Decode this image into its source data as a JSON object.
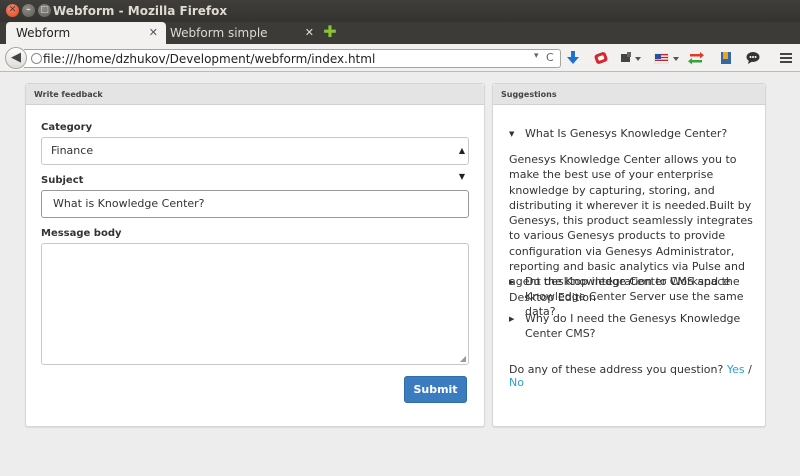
{
  "window": {
    "title": "Webform - Mozilla Firefox",
    "close_glyph": "✕",
    "minimize_glyph": "–",
    "maximize_glyph": "□"
  },
  "tabs": [
    {
      "label": "Webform",
      "active": true
    },
    {
      "label": "Webform simple",
      "active": false
    }
  ],
  "tab_close_glyph": "✕",
  "new_tab_glyph": "✚",
  "nav": {
    "back_glyph": "◀",
    "url": "file:///home/dzhukov/Development/webform/index.html",
    "url_dropdown_glyph": "▾",
    "reload_glyph": "C"
  },
  "toolbar_icons": [
    "download-arrow-icon",
    "addon-red-icon",
    "addon-dark-icon",
    "flag-us-icon",
    "sync-arrows-icon",
    "bookmarks-icon",
    "chat-icon",
    "menu-icon"
  ],
  "colors": {
    "accent": "#3a7cbf",
    "link": "#2a9fd6",
    "window_close": "#e2451d"
  },
  "feedback": {
    "header": "Write feedback",
    "category_label": "Category",
    "category_value": "Finance",
    "subject_label": "Subject",
    "subject_value": "What is Knowledge Center?",
    "message_label": "Message body",
    "message_value": "",
    "submit_label": "Submit"
  },
  "suggestions": {
    "header": "Suggestions",
    "items": [
      {
        "question": "What Is Genesys Knowledge Center?",
        "expanded": true,
        "answer": "Genesys Knowledge Center allows you to make the best use of your enterprise knowledge by capturing, storing, and distributing it wherever it is needed.Built by Genesys, this product seamlessly integrates to various Genesys products to provide configuration via Genesys Administrator, reporting and basic analytics via Pulse and agent desktop integration to Workspace Desktop Edition"
      },
      {
        "question": "Do the Knowledge Center CMS and the Knowledge Center Server use the same data?",
        "expanded": false
      },
      {
        "question": "Why do I need the Genesys Knowledge Center CMS?",
        "expanded": false
      }
    ],
    "address_prompt": "Do any of these address you question?",
    "yes_label": "Yes",
    "separator": "/",
    "no_label": "No",
    "expanded_glyph": "▼",
    "collapsed_glyph": "▶"
  }
}
